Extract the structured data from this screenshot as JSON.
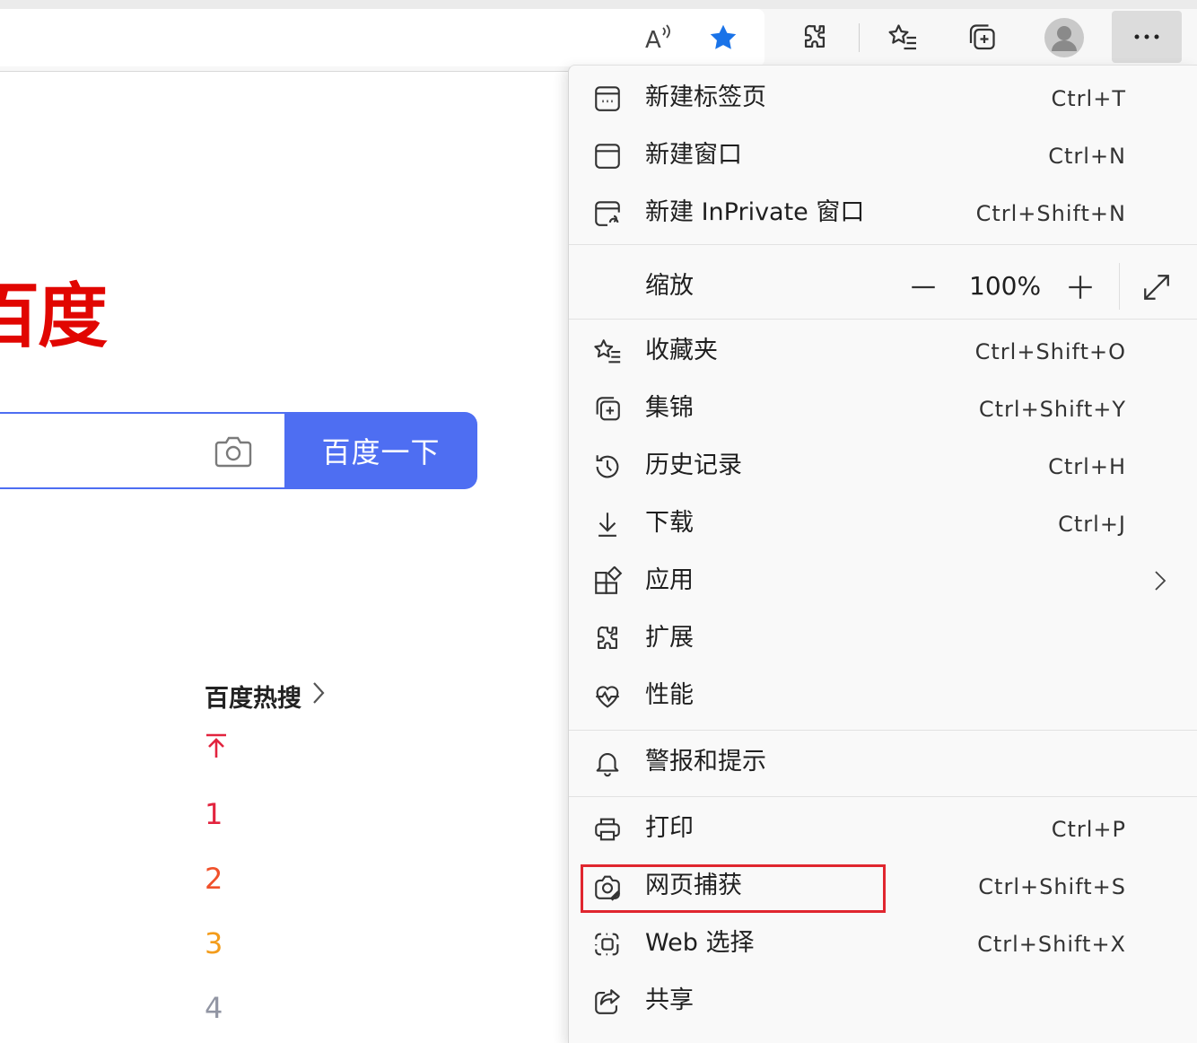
{
  "toolbar": {
    "icons": [
      "read-aloud-icon",
      "favorite-star-icon",
      "extensions-icon",
      "favorites-icon",
      "collections-icon",
      "profile-icon",
      "more-icon"
    ],
    "colors": {
      "star": "#1a73e8"
    }
  },
  "page": {
    "logo_text": "百度",
    "search_button": "百度一下",
    "hot_search_title": "百度热搜",
    "hot_ranks": [
      "1",
      "2",
      "3",
      "4"
    ],
    "colors": {
      "logo": "#e10601",
      "button": "#4e6ef2",
      "rank1": "#e2233e",
      "rank2": "#f0512b",
      "rank3": "#f39c1b",
      "rank4": "#9195a3"
    }
  },
  "menu": {
    "items": [
      {
        "label": "新建标签页",
        "shortcut": "Ctrl+T",
        "icon": "new-tab-icon"
      },
      {
        "label": "新建窗口",
        "shortcut": "Ctrl+N",
        "icon": "new-window-icon"
      },
      {
        "label": "新建 InPrivate 窗口",
        "shortcut": "Ctrl+Shift+N",
        "icon": "inprivate-icon"
      },
      {
        "label": "收藏夹",
        "shortcut": "Ctrl+Shift+O",
        "icon": "favorites-icon"
      },
      {
        "label": "集锦",
        "shortcut": "Ctrl+Shift+Y",
        "icon": "collections-icon"
      },
      {
        "label": "历史记录",
        "shortcut": "Ctrl+H",
        "icon": "history-icon"
      },
      {
        "label": "下载",
        "shortcut": "Ctrl+J",
        "icon": "download-icon"
      },
      {
        "label": "应用",
        "shortcut": "",
        "icon": "apps-icon"
      },
      {
        "label": "扩展",
        "shortcut": "",
        "icon": "extensions-icon"
      },
      {
        "label": "性能",
        "shortcut": "",
        "icon": "performance-icon"
      },
      {
        "label": "警报和提示",
        "shortcut": "",
        "icon": "bell-icon"
      },
      {
        "label": "打印",
        "shortcut": "Ctrl+P",
        "icon": "print-icon"
      },
      {
        "label": "网页捕获",
        "shortcut": "Ctrl+Shift+S",
        "icon": "web-capture-icon"
      },
      {
        "label": "Web 选择",
        "shortcut": "Ctrl+Shift+X",
        "icon": "web-select-icon"
      },
      {
        "label": "共享",
        "shortcut": "",
        "icon": "share-icon"
      }
    ],
    "zoom": {
      "label": "缩放",
      "value": "100%"
    },
    "highlight_color": "#e0262f"
  }
}
